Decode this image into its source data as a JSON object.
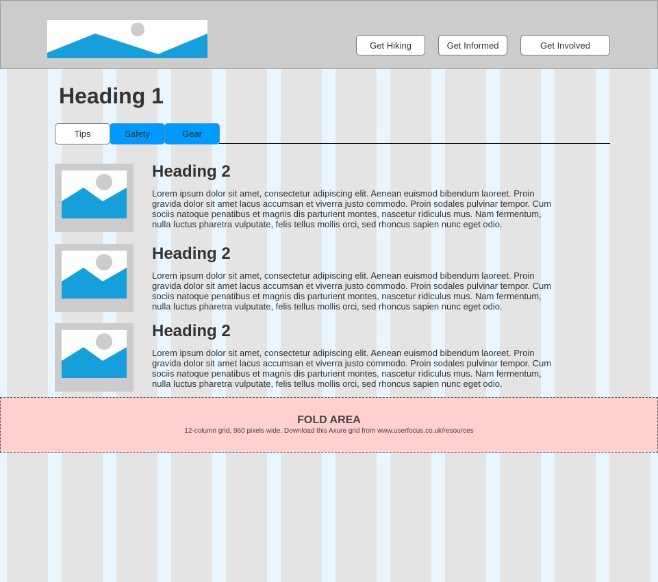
{
  "header": {
    "nav": [
      {
        "label": "Get Hiking"
      },
      {
        "label": "Get Informed"
      },
      {
        "label": "Get Involved"
      }
    ]
  },
  "main": {
    "heading": "Heading 1",
    "tabs": [
      {
        "label": "Tips",
        "state": "selected"
      },
      {
        "label": "Safety",
        "state": "unselected"
      },
      {
        "label": "Gear",
        "state": "unselected"
      }
    ],
    "items": [
      {
        "heading": "Heading 2",
        "body": "Lorem ipsum dolor sit amet, consectetur adipiscing elit. Aenean euismod bibendum laoreet. Proin gravida dolor sit amet lacus accumsan et viverra justo commodo. Proin sodales pulvinar tempor. Cum sociis natoque penatibus et magnis dis parturient montes, nascetur ridiculus mus. Nam fermentum, nulla luctus pharetra vulputate, felis tellus mollis orci, sed rhoncus sapien nunc eget odio."
      },
      {
        "heading": "Heading 2",
        "body": "Lorem ipsum dolor sit amet, consectetur adipiscing elit. Aenean euismod bibendum laoreet. Proin gravida dolor sit amet lacus accumsan et viverra justo commodo. Proin sodales pulvinar tempor. Cum sociis natoque penatibus et magnis dis parturient montes, nascetur ridiculus mus. Nam fermentum, nulla luctus pharetra vulputate, felis tellus mollis orci, sed rhoncus sapien nunc eget odio."
      },
      {
        "heading": "Heading 2",
        "body": "Lorem ipsum dolor sit amet, consectetur adipiscing elit. Aenean euismod bibendum laoreet. Proin gravida dolor sit amet lacus accumsan et viverra justo commodo. Proin sodales pulvinar tempor. Cum sociis natoque penatibus et magnis dis parturient montes, nascetur ridiculus mus. Nam fermentum, nulla luctus pharetra vulputate, felis tellus mollis orci, sed rhoncus sapien nunc eget odio."
      }
    ]
  },
  "fold": {
    "title": "FOLD AREA",
    "subtitle": "12-column grid, 960 pixels wide. Download this Axure grid from www.userfocus.co.uk/resources"
  },
  "icons": {
    "logo": "image-placeholder-icon",
    "thumbnail": "image-placeholder-icon"
  },
  "colors": {
    "header_bg": "#cccccc",
    "tab_active_bg": "#ffffff",
    "tab_inactive_bg": "#0099ff",
    "placeholder_blue": "#169fdb",
    "fold_bg": "#ffd0d0",
    "grid_column": "#e4e4e4",
    "grid_gutter": "#eaf6ff"
  }
}
